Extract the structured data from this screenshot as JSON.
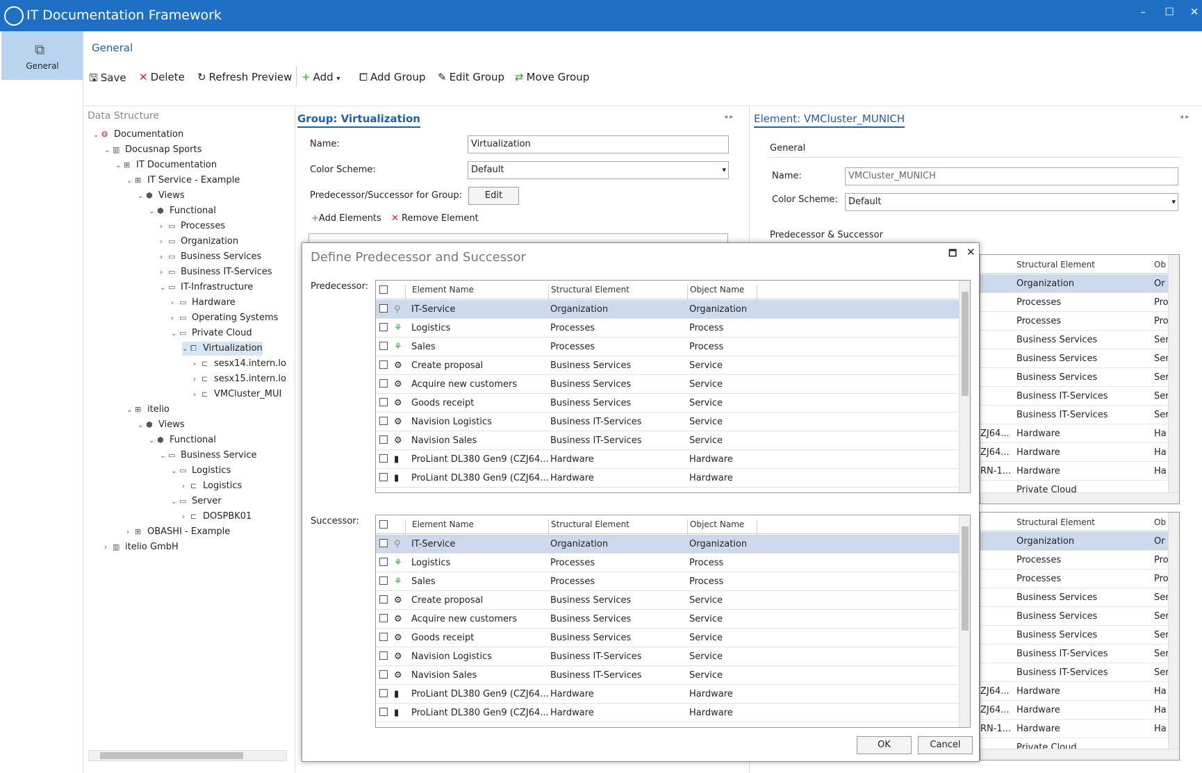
{
  "window": {
    "title": "IT Documentation Framework"
  },
  "leftnav": {
    "general_label": "General"
  },
  "ribbon": {
    "tab_label": "General",
    "save": "Save",
    "delete": "Delete",
    "refresh_preview": "Refresh Preview",
    "add": "Add",
    "add_group": "Add Group",
    "edit_group": "Edit Group",
    "move_group": "Move Group"
  },
  "tree": {
    "header": "Data Structure",
    "items": [
      {
        "label": "Documentation",
        "depth": 0,
        "chev": "v",
        "icon": "doc"
      },
      {
        "label": "Docusnap Sports",
        "depth": 1,
        "chev": "v",
        "icon": "building"
      },
      {
        "label": "IT Documentation",
        "depth": 2,
        "chev": "v",
        "icon": "struct"
      },
      {
        "label": "IT Service - Example",
        "depth": 3,
        "chev": "v",
        "icon": "struct"
      },
      {
        "label": "Views",
        "depth": 4,
        "chev": "v",
        "icon": "cube"
      },
      {
        "label": "Functional",
        "depth": 5,
        "chev": "v",
        "icon": "cube"
      },
      {
        "label": "Processes",
        "depth": 6,
        "chev": ">",
        "icon": "bar"
      },
      {
        "label": "Organization",
        "depth": 6,
        "chev": ">",
        "icon": "bar"
      },
      {
        "label": "Business Services",
        "depth": 6,
        "chev": ">",
        "icon": "bar"
      },
      {
        "label": "Business IT-Services",
        "depth": 6,
        "chev": ">",
        "icon": "bar"
      },
      {
        "label": "IT-Infrastructure",
        "depth": 6,
        "chev": "v",
        "icon": "bar"
      },
      {
        "label": "Hardware",
        "depth": 7,
        "chev": ">",
        "icon": "bar"
      },
      {
        "label": "Operating Systems",
        "depth": 7,
        "chev": ">",
        "icon": "bar"
      },
      {
        "label": "Private Cloud",
        "depth": 7,
        "chev": "v",
        "icon": "bar"
      },
      {
        "label": "Virtualization",
        "depth": 8,
        "chev": "v",
        "icon": "group",
        "selected": true
      },
      {
        "label": "sesx14.intern.lo",
        "depth": 9,
        "chev": ">",
        "icon": "elem"
      },
      {
        "label": "sesx15.intern.lo",
        "depth": 9,
        "chev": ">",
        "icon": "elem"
      },
      {
        "label": "VMCluster_MUI",
        "depth": 9,
        "chev": ">",
        "icon": "elem"
      },
      {
        "label": "itelio",
        "depth": 3,
        "chev": "v",
        "icon": "struct"
      },
      {
        "label": "Views",
        "depth": 4,
        "chev": "v",
        "icon": "cube"
      },
      {
        "label": "Functional",
        "depth": 5,
        "chev": "v",
        "icon": "cube"
      },
      {
        "label": "Business Service",
        "depth": 6,
        "chev": "v",
        "icon": "bar"
      },
      {
        "label": "Logistics",
        "depth": 7,
        "chev": "v",
        "icon": "bar"
      },
      {
        "label": "Logistics",
        "depth": 8,
        "chev": ">",
        "icon": "elem"
      },
      {
        "label": "Server",
        "depth": 7,
        "chev": "v",
        "icon": "bar"
      },
      {
        "label": "DOSPBK01",
        "depth": 8,
        "chev": ">",
        "icon": "elem"
      },
      {
        "label": "OBASHI - Example",
        "depth": 3,
        "chev": ">",
        "icon": "struct"
      },
      {
        "label": "itelio GmbH",
        "depth": 1,
        "chev": ">",
        "icon": "building"
      }
    ]
  },
  "group_panel": {
    "tab": "Group: Virtualization",
    "name_label": "Name:",
    "name_value": "Virtualization",
    "color_label": "Color Scheme:",
    "color_value": "Default",
    "pred_label": "Predecessor/Successor for Group:",
    "edit_button": "Edit",
    "add_elements": "Add Elements",
    "remove_element": "Remove Element"
  },
  "element_panel": {
    "tab": "Element: VMCluster_MUNICH",
    "section": "General",
    "name_label": "Name:",
    "name_value": "VMCluster_MUNICH",
    "color_label": "Color Scheme:",
    "color_value": "Default",
    "pred_succ_label": "Predecessor & Successor",
    "columns": [
      "Structural Element",
      "Ob"
    ],
    "rows": [
      {
        "pre": "",
        "struct": "Organization",
        "ob": "Or",
        "sel": true
      },
      {
        "pre": "",
        "struct": "Processes",
        "ob": "Pro"
      },
      {
        "pre": "",
        "struct": "Processes",
        "ob": "Pro"
      },
      {
        "pre": "",
        "struct": "Business Services",
        "ob": "Ser"
      },
      {
        "pre": "",
        "struct": "Business Services",
        "ob": "Ser"
      },
      {
        "pre": "",
        "struct": "Business Services",
        "ob": "Ser"
      },
      {
        "pre": "",
        "struct": "Business IT-Services",
        "ob": "Ser"
      },
      {
        "pre": "",
        "struct": "Business IT-Services",
        "ob": "Ser"
      },
      {
        "pre": "ZJ64...",
        "struct": "Hardware",
        "ob": "Ha"
      },
      {
        "pre": "ZJ64...",
        "struct": "Hardware",
        "ob": "Ha"
      },
      {
        "pre": "RN-1...",
        "struct": "Hardware",
        "ob": "Ha"
      },
      {
        "pre": "",
        "struct": "Private Cloud",
        "ob": ""
      }
    ]
  },
  "dialog": {
    "title": "Define Predecessor and Successor",
    "pred_label": "Predecessor:",
    "succ_label": "Successor:",
    "columns": [
      "Element Name",
      "Structural Element",
      "Object Name"
    ],
    "rows": [
      {
        "name": "IT-Service",
        "struct": "Organization",
        "obj": "Organization",
        "icon": "org",
        "sel": true
      },
      {
        "name": "Logistics",
        "struct": "Processes",
        "obj": "Process",
        "icon": "proc"
      },
      {
        "name": "Sales",
        "struct": "Processes",
        "obj": "Process",
        "icon": "proc"
      },
      {
        "name": "Create proposal",
        "struct": "Business Services",
        "obj": "Service",
        "icon": "gear"
      },
      {
        "name": "Acquire new customers",
        "struct": "Business Services",
        "obj": "Service",
        "icon": "gear"
      },
      {
        "name": "Goods receipt",
        "struct": "Business Services",
        "obj": "Service",
        "icon": "gear"
      },
      {
        "name": "Navision Logistics",
        "struct": "Business IT-Services",
        "obj": "Service",
        "icon": "gear"
      },
      {
        "name": "Navision Sales",
        "struct": "Business IT-Services",
        "obj": "Service",
        "icon": "gear"
      },
      {
        "name": "ProLiant DL380 Gen9 (CZJ64...",
        "struct": "Hardware",
        "obj": "Hardware",
        "icon": "hw"
      },
      {
        "name": "ProLiant DL380 Gen9 (CZJ64...",
        "struct": "Hardware",
        "obj": "Hardware",
        "icon": "hw"
      }
    ],
    "ok": "OK",
    "cancel": "Cancel"
  }
}
